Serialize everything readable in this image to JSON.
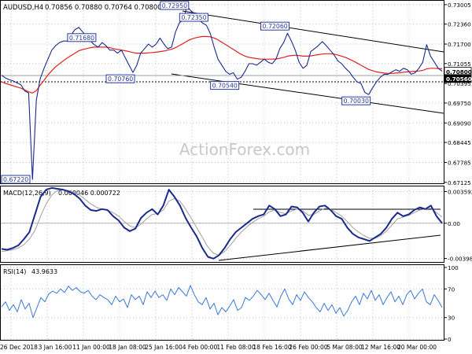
{
  "header": {
    "symbol": "AUDUSD,H4",
    "ohlc": "0.70856 0.70880 0.70764 0.70800"
  },
  "watermark": "ActionForex.com",
  "colors": {
    "price": "#1a2a8c",
    "ma": "#e02020",
    "macd": "#1a2a8c",
    "signal": "#a0a0a0",
    "rsi": "#3a78d6",
    "grid": "#b8c4d4",
    "box": "#2a3a9a",
    "trend": "#000000"
  },
  "chart_data": [
    {
      "type": "line",
      "panel": "price",
      "ylim": [
        0.6712,
        0.7308
      ],
      "yticks": [
        "0.73005",
        "0.72360",
        "0.71700",
        "0.71055",
        "0.70395",
        "0.69750",
        "0.69090",
        "0.68445",
        "0.67785",
        "0.67125"
      ],
      "ytick_values": [
        0.73005,
        0.7236,
        0.717,
        0.71055,
        0.70395,
        0.6975,
        0.6909,
        0.68445,
        0.67785,
        0.67125
      ],
      "current_price_labels": [
        "0.70800",
        "0.70560"
      ],
      "xticks": [
        "26 Dec 2018",
        "3 Jan 16:00",
        "11 Jan 00:00",
        "18 Jan 08:00",
        "25 Jan 16:00",
        "4 Feb 00:00",
        "11 Feb 08:00",
        "18 Feb 16:00",
        "26 Feb 00:00",
        "5 Mar 08:00",
        "12 Mar 16:00",
        "20 Mar 00:00"
      ],
      "series": [
        {
          "values": [
            0.7067,
            0.7058,
            0.7052,
            0.7048,
            0.7042,
            0.7035,
            0.7015,
            0.7008,
            0.6722,
            0.6985,
            0.7055,
            0.709,
            0.712,
            0.715,
            0.7165,
            0.7175,
            0.718,
            0.718,
            0.72,
            0.7218,
            0.7225,
            0.721,
            0.7195,
            0.718,
            0.7168,
            0.716,
            0.7175,
            0.7165,
            0.715,
            0.715,
            0.714,
            0.715,
            0.7125,
            0.71,
            0.7076,
            0.71,
            0.714,
            0.7155,
            0.717,
            0.716,
            0.717,
            0.719,
            0.717,
            0.7155,
            0.716,
            0.721,
            0.724,
            0.725,
            0.7295,
            0.728,
            0.727,
            0.725,
            0.724,
            0.7232,
            0.7205,
            0.716,
            0.712,
            0.71,
            0.708,
            0.707,
            0.7075,
            0.7054,
            0.706,
            0.708,
            0.7105,
            0.7105,
            0.71,
            0.711,
            0.712,
            0.711,
            0.7105,
            0.712,
            0.7155,
            0.7175,
            0.7206,
            0.718,
            0.715,
            0.711,
            0.709,
            0.71,
            0.7145,
            0.7155,
            0.7165,
            0.7178,
            0.7165,
            0.715,
            0.7135,
            0.7115,
            0.7105,
            0.709,
            0.7078,
            0.706,
            0.7045,
            0.704,
            0.701,
            0.7003,
            0.7025,
            0.7045,
            0.706,
            0.707,
            0.707,
            0.7078,
            0.7085,
            0.708,
            0.709,
            0.7085,
            0.707,
            0.7075,
            0.709,
            0.711,
            0.7168,
            0.713,
            0.711,
            0.709,
            0.708
          ]
        },
        {
          "values": [
            0.7045,
            0.704,
            0.7036,
            0.7032,
            0.7028,
            0.7024,
            0.7018,
            0.7012,
            0.7008,
            0.7016,
            0.7034,
            0.705,
            0.7068,
            0.7082,
            0.7095,
            0.7105,
            0.7115,
            0.7124,
            0.7132,
            0.714,
            0.7148,
            0.7152,
            0.7155,
            0.7158,
            0.716,
            0.716,
            0.716,
            0.716,
            0.7158,
            0.7155,
            0.7152,
            0.715,
            0.7148,
            0.7145,
            0.7142,
            0.714,
            0.714,
            0.714,
            0.7141,
            0.7142,
            0.7143,
            0.7145,
            0.7147,
            0.715,
            0.7153,
            0.7158,
            0.7165,
            0.7172,
            0.718,
            0.7186,
            0.719,
            0.7193,
            0.7195,
            0.7195,
            0.7194,
            0.719,
            0.7184,
            0.7176,
            0.7168,
            0.716,
            0.7152,
            0.7144,
            0.7136,
            0.713,
            0.7126,
            0.7124,
            0.7122,
            0.712,
            0.712,
            0.712,
            0.712,
            0.7121,
            0.7123,
            0.7126,
            0.713,
            0.7132,
            0.7133,
            0.7132,
            0.713,
            0.713,
            0.7131,
            0.7133,
            0.7135,
            0.7137,
            0.7138,
            0.7138,
            0.7137,
            0.7134,
            0.713,
            0.7126,
            0.712,
            0.7114,
            0.7107,
            0.71,
            0.7093,
            0.7086,
            0.7082,
            0.7078,
            0.7076,
            0.7074,
            0.7073,
            0.7073,
            0.7074,
            0.7075,
            0.7077,
            0.7078,
            0.7079,
            0.708,
            0.7081,
            0.7083,
            0.7088,
            0.709,
            0.709,
            0.7089,
            0.7088
          ]
        }
      ],
      "annotations": [
        "0.72350",
        "0.72950",
        "0.70760",
        "0.70540",
        "0.72060",
        "0.70030",
        "0.71680",
        "0.67220"
      ],
      "annotation_values": [
        0.7235,
        0.7295,
        0.7076,
        0.7054,
        0.7206,
        0.7003,
        0.7168,
        0.6722
      ]
    },
    {
      "type": "line",
      "panel": "macd",
      "title": "MACD(12,26,9)",
      "title_values": "0.000046 0.000722",
      "ylim": [
        -0.0042,
        0.0039
      ],
      "yticks": [
        "0.003592",
        "0.00",
        "-0.003986"
      ],
      "ytick_values": [
        0.003592,
        0.0,
        -0.003986
      ],
      "series": [
        {
          "values": [
            -0.0029,
            -0.003,
            -0.0028,
            -0.0025,
            -0.0018,
            -0.001,
            0.001,
            0.003,
            0.0038,
            0.004,
            0.0039,
            0.0038,
            0.0036,
            0.0033,
            0.0028,
            0.002,
            0.0015,
            0.0014,
            0.0016,
            0.0015,
            0.0008,
            0.0003,
            -0.0005,
            -0.0009,
            -0.0006,
            0.0006,
            0.0012,
            0.0016,
            0.001,
            0.002,
            0.0038,
            0.003,
            0.002,
            0.0006,
            -0.0005,
            -0.0015,
            -0.0028,
            -0.0038,
            -0.004,
            -0.0036,
            -0.0028,
            -0.0018,
            -0.001,
            -0.0005,
            0.0,
            0.0005,
            0.0008,
            0.001,
            0.002,
            0.0016,
            0.0008,
            0.001,
            0.0019,
            0.0018,
            0.0012,
            0.0002,
            0.0012,
            0.0019,
            0.002,
            0.0015,
            0.0008,
            0.0005,
            -0.0005,
            -0.0012,
            -0.0016,
            -0.0018,
            -0.002,
            -0.0016,
            -0.0012,
            -0.0005,
            0.0005,
            0.0012,
            0.0008,
            0.001,
            0.0015,
            0.0018,
            0.0016,
            0.002,
            0.0008,
            0.0
          ]
        },
        {
          "values": [
            -0.0032,
            -0.0031,
            -0.003,
            -0.0028,
            -0.0024,
            -0.0018,
            -0.0008,
            0.0008,
            0.0022,
            0.0032,
            0.0037,
            0.0038,
            0.0037,
            0.0035,
            0.0032,
            0.0027,
            0.0022,
            0.0018,
            0.0016,
            0.0015,
            0.0012,
            0.0008,
            0.0002,
            -0.0003,
            -0.0005,
            -0.0001,
            0.0005,
            0.001,
            0.0011,
            0.0015,
            0.0025,
            0.0028,
            0.0025,
            0.0016,
            0.0006,
            -0.0005,
            -0.0016,
            -0.0027,
            -0.0034,
            -0.0036,
            -0.0032,
            -0.0025,
            -0.0017,
            -0.001,
            -0.0004,
            0.0001,
            0.0005,
            0.0008,
            0.0013,
            0.0015,
            0.0012,
            0.0011,
            0.0014,
            0.0016,
            0.0014,
            0.0009,
            0.001,
            0.0014,
            0.0017,
            0.0016,
            0.0012,
            0.0008,
            0.0002,
            -0.0005,
            -0.001,
            -0.0014,
            -0.0017,
            -0.0017,
            -0.0014,
            -0.0009,
            -0.0002,
            0.0005,
            0.0007,
            0.0009,
            0.0012,
            0.0015,
            0.0016,
            0.0017,
            0.0012,
            0.0007
          ]
        }
      ]
    },
    {
      "type": "line",
      "panel": "rsi",
      "title": "RSI(14)",
      "title_value": "43.9633",
      "ylim": [
        0,
        100
      ],
      "yticks": [
        "100",
        "70",
        "30",
        "0"
      ],
      "ytick_values": [
        100,
        70,
        30,
        0
      ],
      "series": [
        {
          "values": [
            45,
            52,
            40,
            48,
            38,
            55,
            42,
            50,
            30,
            44,
            58,
            52,
            63,
            67,
            64,
            70,
            65,
            74,
            68,
            72,
            66,
            64,
            68,
            60,
            55,
            62,
            58,
            55,
            48,
            60,
            52,
            56,
            44,
            62,
            55,
            60,
            48,
            66,
            58,
            67,
            58,
            62,
            54,
            70,
            62,
            72,
            66,
            60,
            75,
            62,
            52,
            48,
            58,
            42,
            50,
            34,
            44,
            38,
            46,
            55,
            40,
            44,
            58,
            54,
            60,
            68,
            62,
            55,
            64,
            54,
            45,
            60,
            70,
            56,
            48,
            62,
            54,
            66,
            58,
            52,
            44,
            38,
            50,
            40,
            48,
            36,
            44,
            32,
            40,
            52,
            60,
            48,
            64,
            56,
            68,
            54,
            62,
            48,
            58,
            66,
            52,
            60,
            48,
            62,
            68,
            56,
            64,
            70,
            52,
            48,
            62,
            54,
            44
          ]
        }
      ]
    }
  ]
}
